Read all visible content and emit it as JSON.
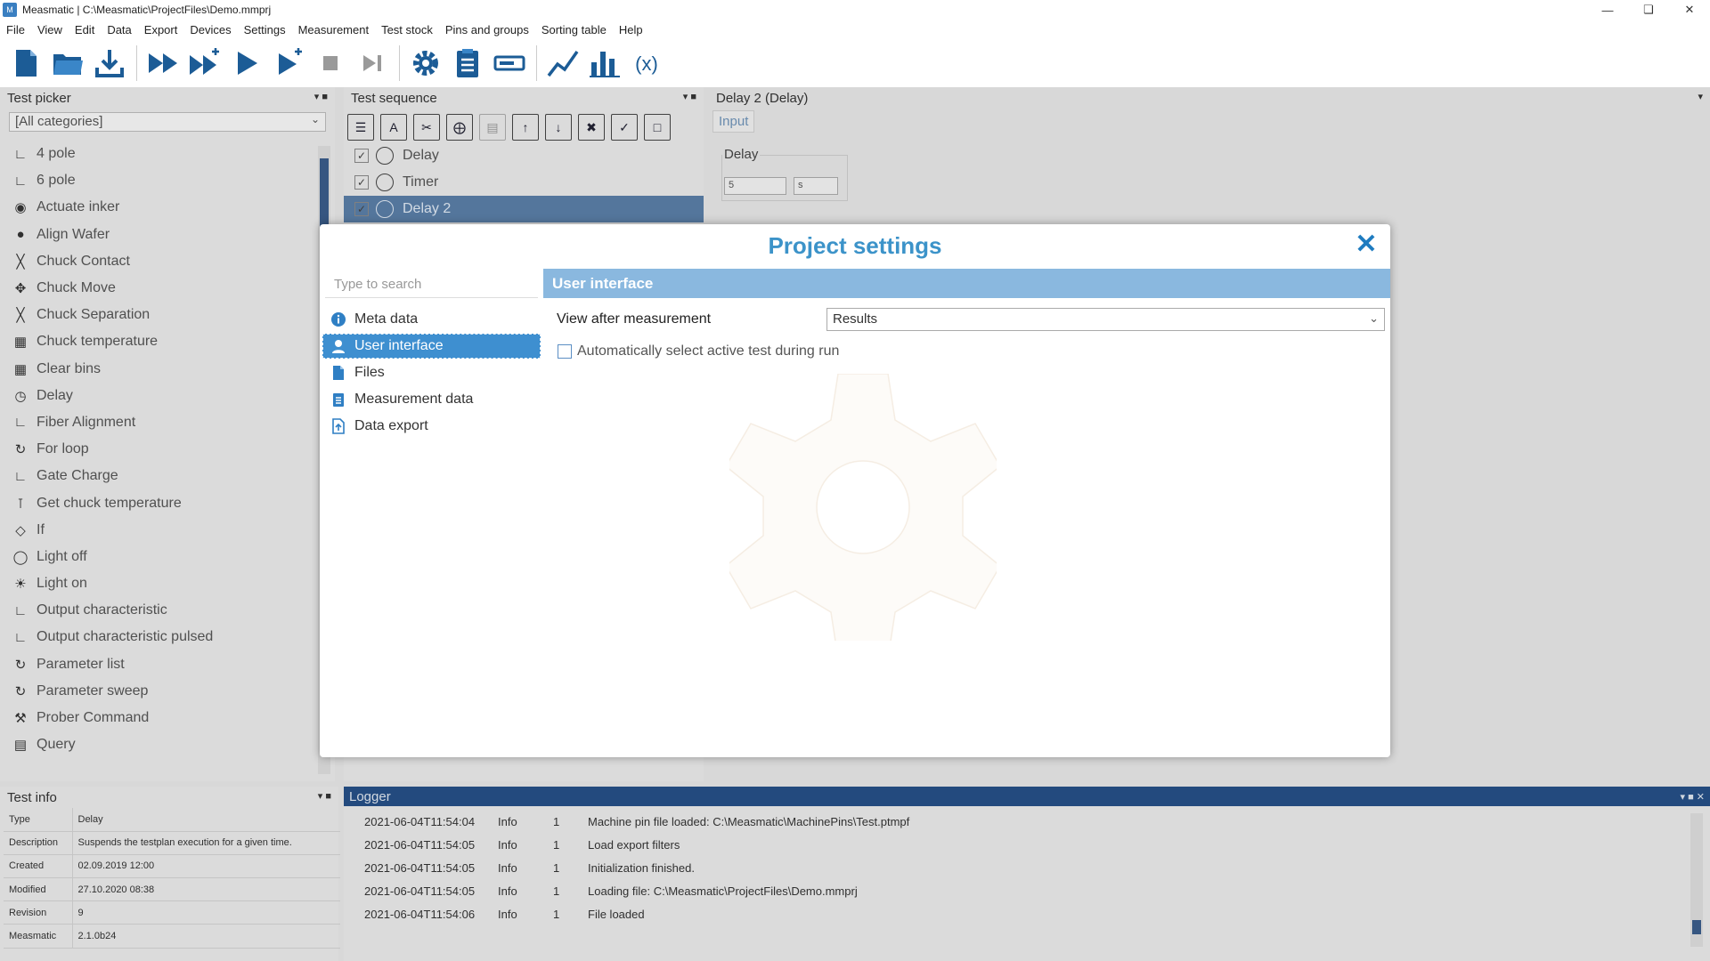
{
  "window": {
    "title": "Measmatic | C:\\Measmatic\\ProjectFiles\\Demo.mmprj"
  },
  "menu": [
    "File",
    "View",
    "Edit",
    "Data",
    "Export",
    "Devices",
    "Settings",
    "Measurement",
    "Test stock",
    "Pins and groups",
    "Sorting table",
    "Help"
  ],
  "toolbar": {
    "icons": [
      "new-file-icon",
      "open-folder-icon",
      "download-icon",
      "fast-forward-icon",
      "fast-forward-plus-icon",
      "play-icon",
      "play-plus-icon",
      "stop-icon",
      "step-end-icon",
      "gear-icon",
      "clipboard-icon",
      "device-icon",
      "line-chart-icon",
      "bar-chart-icon",
      "variable-icon"
    ]
  },
  "picker": {
    "title": "Test picker",
    "category": "[All categories]",
    "items": [
      "4 pole",
      "6 pole",
      "Actuate inker",
      "Align Wafer",
      "Chuck Contact",
      "Chuck Move",
      "Chuck Separation",
      "Chuck temperature",
      "Clear bins",
      "Delay",
      "Fiber Alignment",
      "For loop",
      "Gate Charge",
      "Get chuck temperature",
      "If",
      "Light off",
      "Light on",
      "Output characteristic",
      "Output characteristic pulsed",
      "Parameter list",
      "Parameter sweep",
      "Prober Command",
      "Query"
    ]
  },
  "sequence": {
    "title": "Test sequence",
    "rows": [
      {
        "label": "Delay",
        "checked": true
      },
      {
        "label": "Timer",
        "checked": true
      },
      {
        "label": "Delay 2",
        "checked": true
      }
    ]
  },
  "delay_panel": {
    "title": "Delay 2 (Delay)",
    "tab": "Input",
    "group_label": "Delay",
    "value": "5",
    "unit": "s"
  },
  "test_info": {
    "title": "Test info",
    "rows": [
      {
        "k": "Type",
        "v": "Delay"
      },
      {
        "k": "Description",
        "v": "Suspends the testplan execution for a given time."
      },
      {
        "k": "Created",
        "v": "02.09.2019 12:00"
      },
      {
        "k": "Modified",
        "v": "27.10.2020 08:38"
      },
      {
        "k": "Revision",
        "v": "9"
      },
      {
        "k": "Measmatic",
        "v": "2.1.0b24"
      }
    ]
  },
  "logger": {
    "title": "Logger",
    "rows": [
      {
        "ts": "2021-06-04T11:54:04",
        "level": "Info",
        "n": "1",
        "msg": "Machine pin file loaded: C:\\Measmatic\\MachinePins\\Test.ptmpf"
      },
      {
        "ts": "2021-06-04T11:54:05",
        "level": "Info",
        "n": "1",
        "msg": "Load export filters"
      },
      {
        "ts": "2021-06-04T11:54:05",
        "level": "Info",
        "n": "1",
        "msg": "Initialization finished."
      },
      {
        "ts": "2021-06-04T11:54:05",
        "level": "Info",
        "n": "1",
        "msg": "Loading file: C:\\Measmatic\\ProjectFiles\\Demo.mmprj"
      },
      {
        "ts": "2021-06-04T11:54:06",
        "level": "Info",
        "n": "1",
        "msg": "File loaded"
      }
    ]
  },
  "modal": {
    "title": "Project settings",
    "search_placeholder": "Type to search",
    "nav": [
      {
        "label": "Meta data",
        "icon": "info-icon"
      },
      {
        "label": "User interface",
        "icon": "user-icon",
        "selected": true
      },
      {
        "label": "Files",
        "icon": "file-icon"
      },
      {
        "label": "Measurement data",
        "icon": "clipboard-icon"
      },
      {
        "label": "Data export",
        "icon": "export-icon"
      }
    ],
    "section_title": "User interface",
    "view_after_label": "View after measurement",
    "view_after_value": "Results",
    "auto_select_label": "Automatically select active test during run",
    "auto_select_checked": false
  },
  "colors": {
    "accent": "#3c93c9",
    "selected": "#3e8fd0",
    "header": "#8ab8df",
    "logger_header": "#264f86"
  }
}
